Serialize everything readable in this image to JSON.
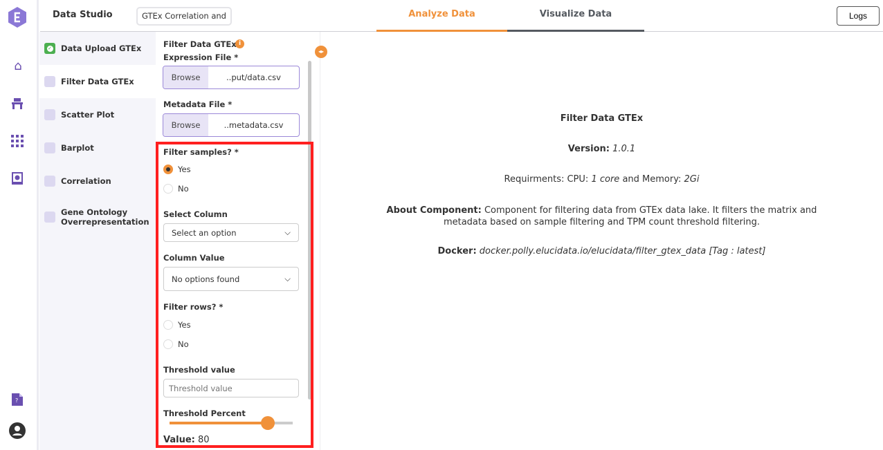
{
  "app": {
    "brand": "Data Studio",
    "project_name": "GTEx Correlation and",
    "logs_label": "Logs"
  },
  "tabs": [
    {
      "label": "Analyze Data",
      "active": true,
      "color": "#f0913a"
    },
    {
      "label": "Visualize Data",
      "active": false,
      "color": "#555a60"
    }
  ],
  "nav_icons": [
    "logo-icon",
    "home-icon",
    "workspace-icon",
    "apps-grid-icon",
    "notebook-icon",
    "help-doc-icon",
    "user-account-icon"
  ],
  "steps": [
    {
      "label": "Data Upload GTEx",
      "status": "done"
    },
    {
      "label": "Filter Data GTEx",
      "status": "active"
    },
    {
      "label": "Scatter Plot",
      "status": "pending"
    },
    {
      "label": "Barplot",
      "status": "pending"
    },
    {
      "label": "Correlation",
      "status": "pending"
    },
    {
      "label": "Gene Ontology Overrepresentation",
      "status": "pending"
    }
  ],
  "form": {
    "title": "Filter Data GTEx",
    "expression_label": "Expression File *",
    "expression_browse": "Browse",
    "expression_file": "..put/data.csv",
    "metadata_label": "Metadata File *",
    "metadata_browse": "Browse",
    "metadata_file": "..metadata.csv",
    "filter_samples_label": "Filter samples? *",
    "filter_samples_options": [
      "Yes",
      "No"
    ],
    "filter_samples_value": "Yes",
    "select_column_label": "Select Column",
    "select_column_value": "Select an option",
    "column_value_label": "Column Value",
    "column_value_value": "No options found",
    "filter_rows_label": "Filter rows? *",
    "filter_rows_options": [
      "Yes",
      "No"
    ],
    "threshold_value_label": "Threshold value",
    "threshold_value_placeholder": "Threshold value",
    "threshold_percent_label": "Threshold Percent",
    "threshold_percent": 80,
    "value_label": "Value:",
    "value_text": "80"
  },
  "info": {
    "title": "Filter Data GTEx",
    "version_label": "Version:",
    "version": "1.0.1",
    "req_prefix": "Requirments: CPU:",
    "cpu": "1 core",
    "req_mid": "and Memory:",
    "memory": "2Gi",
    "about_label": "About Component:",
    "about_text": "Component for filtering data from GTEx data lake. It filters the matrix and metadata based on sample filtering and TPM count threshold filtering.",
    "docker_label": "Docker:",
    "docker_text": "docker.polly.elucidata.io/elucidata/filter_gtex_data [Tag : latest]"
  },
  "colors": {
    "accent": "#f0913a",
    "brand": "#6a4fb0",
    "highlight": "#ff1f1f"
  }
}
